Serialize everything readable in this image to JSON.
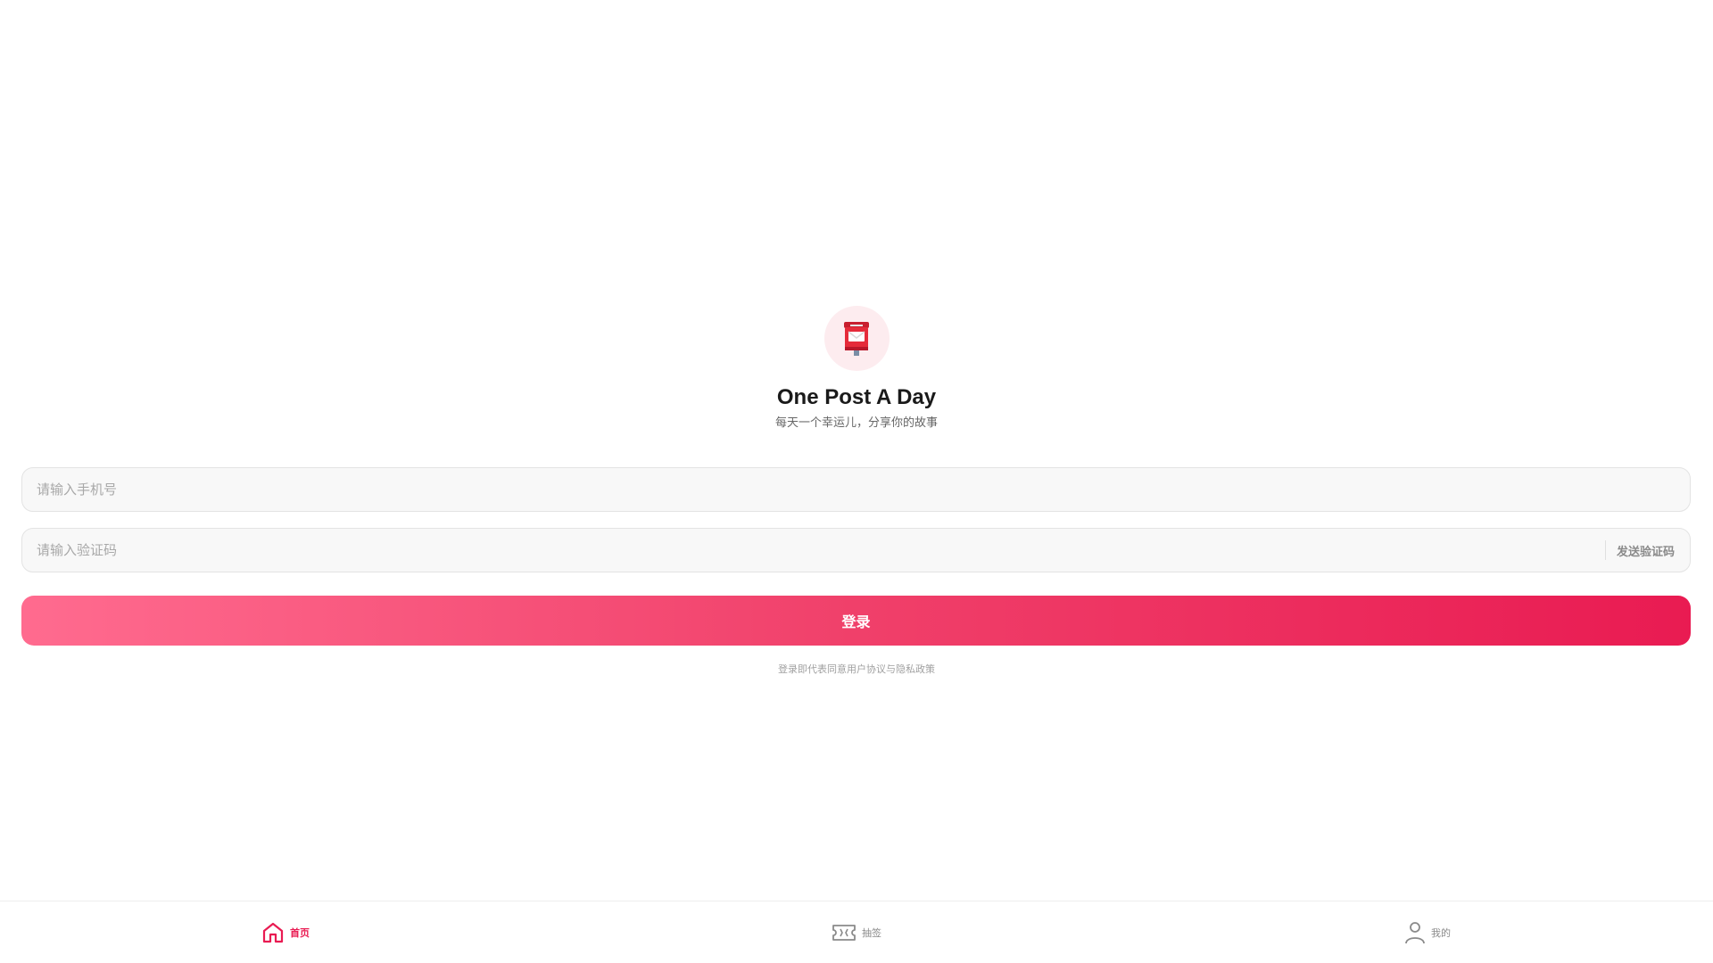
{
  "brand": {
    "logo_icon": "postbox-icon",
    "title": "One Post A Day",
    "slogan": "每天一个幸运儿，分享你的故事"
  },
  "form": {
    "phone_placeholder": "请输入手机号",
    "code_placeholder": "请输入验证码",
    "send_code_label": "发送验证码",
    "login_label": "登录",
    "agreement_text": "登录即代表同意用户协议与隐私政策"
  },
  "colors": {
    "accent": "#e91b52",
    "gradient_start": "#ff6b8f",
    "gradient_end": "#e91b52",
    "logo_bg": "#fdecef"
  },
  "nav": {
    "items": [
      {
        "label": "首页",
        "icon": "home-icon",
        "active": true
      },
      {
        "label": "抽签",
        "icon": "ticket-icon",
        "active": false
      },
      {
        "label": "我的",
        "icon": "user-icon",
        "active": false
      }
    ]
  }
}
